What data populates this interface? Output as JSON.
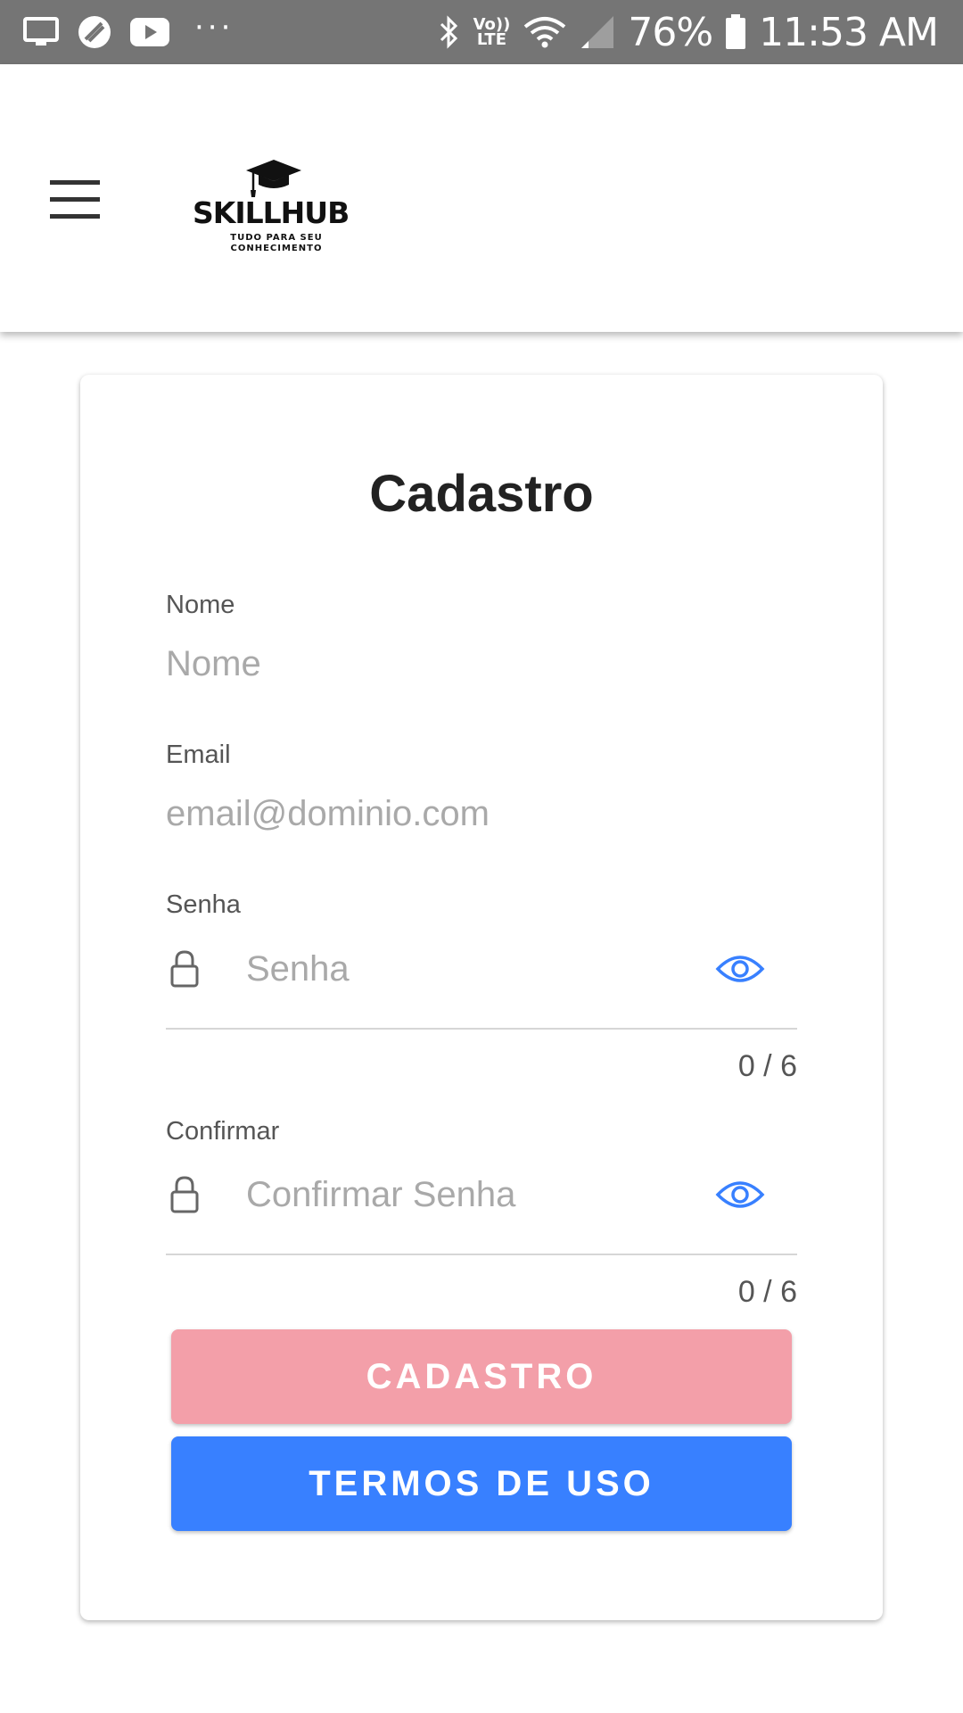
{
  "status_bar": {
    "battery": "76%",
    "time": "11:53 AM",
    "network_badge_top": "Vo))",
    "network_badge_bottom": "LTE",
    "overflow": "···"
  },
  "header": {
    "logo_title": "SKILLHUB",
    "logo_tagline_line1": "TUDO PARA SEU",
    "logo_tagline_line2": "CONHECIMENTO"
  },
  "form": {
    "title": "Cadastro",
    "name": {
      "label": "Nome",
      "placeholder": "Nome",
      "value": ""
    },
    "email": {
      "label": "Email",
      "placeholder": "email@dominio.com",
      "value": ""
    },
    "password": {
      "label": "Senha",
      "placeholder": "Senha",
      "value": "",
      "counter": "0 / 6"
    },
    "confirm": {
      "label": "Confirmar",
      "placeholder": "Confirmar Senha",
      "value": "",
      "counter": "0 / 6"
    },
    "register_button": "CADASTRO",
    "terms_button": "TERMOS DE USO"
  },
  "colors": {
    "status_bar": "#757575",
    "register_button": "#f39fa9",
    "terms_button": "#3880ff",
    "eye_icon": "#3880ff"
  },
  "icons": [
    "monitor-icon",
    "app-icon",
    "youtube-icon",
    "bluetooth-icon",
    "wifi-icon",
    "signal-icon",
    "battery-icon",
    "menu-icon",
    "graduation-cap-icon",
    "lock-icon",
    "eye-icon"
  ]
}
